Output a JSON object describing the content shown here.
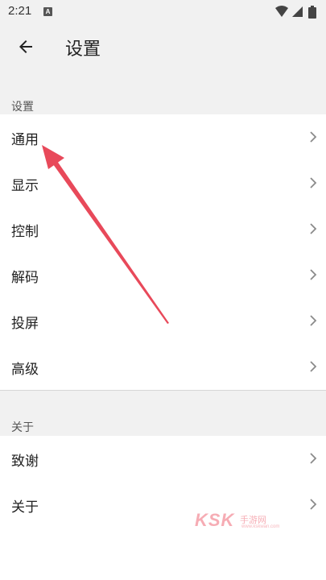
{
  "status_bar": {
    "time": "2:21",
    "notification_badge": "A",
    "icons": [
      "wifi-icon",
      "cellular-signal-icon",
      "battery-icon"
    ]
  },
  "app_bar": {
    "back_icon": "arrow-back-icon",
    "title": "设置"
  },
  "sections": [
    {
      "header": "设置",
      "items": [
        {
          "label": "通用",
          "icon": "chevron-right-icon"
        },
        {
          "label": "显示",
          "icon": "chevron-right-icon"
        },
        {
          "label": "控制",
          "icon": "chevron-right-icon"
        },
        {
          "label": "解码",
          "icon": "chevron-right-icon"
        },
        {
          "label": "投屏",
          "icon": "chevron-right-icon"
        },
        {
          "label": "高级",
          "icon": "chevron-right-icon"
        }
      ]
    },
    {
      "header": "关于",
      "items": [
        {
          "label": "致谢",
          "icon": "chevron-right-icon"
        },
        {
          "label": "关于",
          "icon": "chevron-right-icon"
        }
      ]
    }
  ],
  "watermark": {
    "brand": "KSK",
    "sub": "手游网",
    "url": "www.kskwan.com"
  },
  "colors": {
    "background": "#ffffff",
    "bar_background": "#f1f1f1",
    "text_primary": "#222222",
    "text_secondary": "#555555",
    "chevron": "#8a8a8a",
    "annotation_arrow": "#e8495a"
  }
}
